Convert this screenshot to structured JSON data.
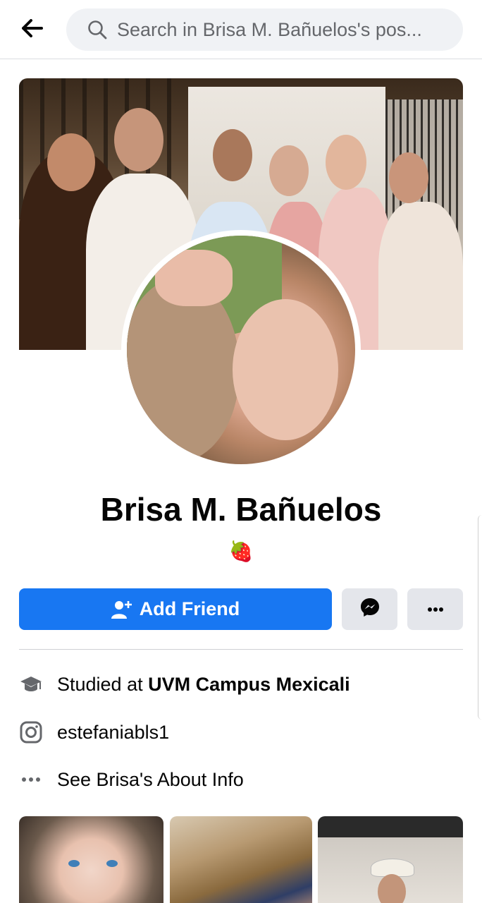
{
  "search": {
    "placeholder": "Search in Brisa M. Bañuelos's pos..."
  },
  "profile": {
    "name": "Brisa M. Bañuelos",
    "bio": "🍓"
  },
  "actions": {
    "add_friend_label": "Add Friend"
  },
  "info": {
    "study_prefix": "Studied at ",
    "study_place": "UVM Campus Mexicali",
    "instagram": "estefaniabls1",
    "about_link": "See Brisa's About Info"
  },
  "colors": {
    "accent": "#1877f2",
    "secondary_button": "#e4e6eb",
    "search_bg": "#f0f2f5"
  },
  "icons": {
    "back": "arrow-left-icon",
    "search": "search-icon",
    "add_friend": "add-friend-icon",
    "messenger": "messenger-icon",
    "more": "more-dots-icon",
    "study": "graduation-cap-icon",
    "instagram": "instagram-icon",
    "about": "dots-icon"
  }
}
